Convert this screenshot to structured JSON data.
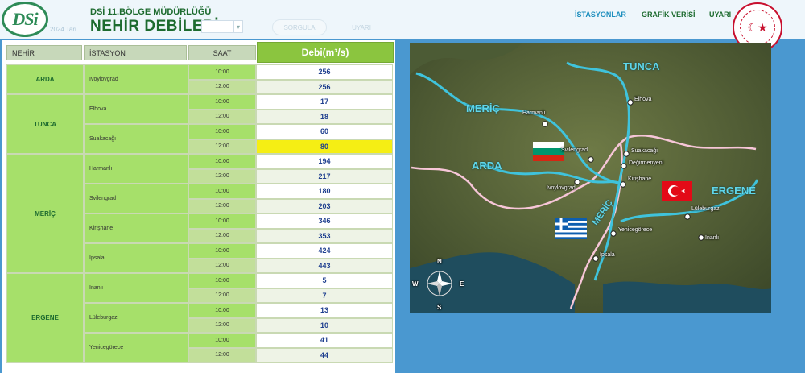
{
  "header": {
    "logo_text": "DSi",
    "department": "DSİ 11.BÖLGE MÜDÜRLÜĞÜ",
    "title": "NEHİR DEBİLERİ",
    "ghost_date_label": "2024 Tari",
    "query_button": "SORGULA",
    "warning_button": "UYARI"
  },
  "nav": {
    "stations": "İSTASYONLAR",
    "chart": "GRAFİK VERİSİ",
    "warnings": "UYARI"
  },
  "table": {
    "headers": {
      "river": "NEHİR",
      "station": "İSTASYON",
      "time": "SAAT",
      "flow": "Debi(m³/s)"
    },
    "times": [
      "10:00",
      "12:00"
    ],
    "rivers": [
      {
        "name": "ARDA",
        "stations": [
          {
            "name": "Ivoylovgrad",
            "flows": [
              "256",
              "256"
            ]
          }
        ]
      },
      {
        "name": "TUNCA",
        "stations": [
          {
            "name": "Elhova",
            "flows": [
              "17",
              "18"
            ]
          },
          {
            "name": "Suakacağı",
            "flows": [
              "60",
              "80"
            ],
            "alert": [
              false,
              true
            ]
          }
        ]
      },
      {
        "name": "MERİÇ",
        "stations": [
          {
            "name": "Harmanlı",
            "flows": [
              "194",
              "217"
            ]
          },
          {
            "name": "Svilengrad",
            "flows": [
              "180",
              "203"
            ]
          },
          {
            "name": "Kirişhane",
            "flows": [
              "346",
              "353"
            ]
          },
          {
            "name": "Ipsala",
            "flows": [
              "424",
              "443"
            ]
          }
        ]
      },
      {
        "name": "ERGENE",
        "stations": [
          {
            "name": "Inanlı",
            "flows": [
              "5",
              "7"
            ]
          },
          {
            "name": "Lüleburgaz",
            "flows": [
              "13",
              "10"
            ]
          },
          {
            "name": "Yenicegörece",
            "flows": [
              "41",
              "44"
            ]
          }
        ]
      }
    ]
  },
  "map": {
    "river_labels": [
      "TUNCA",
      "MERİÇ",
      "ARDA",
      "MERİÇ",
      "ERGENE"
    ],
    "stations": [
      "Elhova",
      "Harmanlı",
      "Svilengrad",
      "Suakacağı",
      "Değirmenyeni",
      "Kirişhane",
      "Ivoylovgrad",
      "Lüleburgaz",
      "İnanlı",
      "Yenicegörece",
      "İpsala"
    ],
    "compass": [
      "N",
      "W",
      "E",
      "S"
    ],
    "colors": {
      "river": "#3fc3dc",
      "border": "#f7c6d8",
      "land": "#5b6b3a",
      "sea": "#1f4d5e"
    }
  },
  "colors": {
    "page_bg": "#4a98d0",
    "header_green": "#1d6b2f",
    "cell_green": "#a6e06a",
    "flow_header": "#8bc53f",
    "alert_yellow": "#f5ee14",
    "value_blue": "#1f3f8f"
  }
}
